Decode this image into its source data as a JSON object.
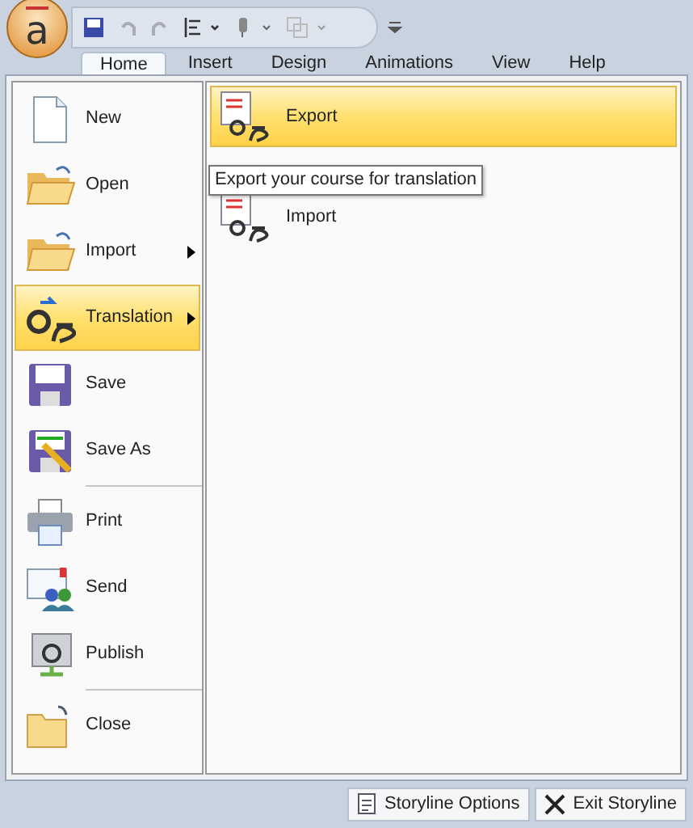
{
  "app_button": {
    "label": "a"
  },
  "tabs": [
    {
      "label": "Home",
      "selected": true
    },
    {
      "label": "Insert",
      "selected": false
    },
    {
      "label": "Design",
      "selected": false
    },
    {
      "label": "Animations",
      "selected": false
    },
    {
      "label": "View",
      "selected": false
    },
    {
      "label": "Help",
      "selected": false
    }
  ],
  "menu": [
    {
      "label": "New",
      "selected": false,
      "has_submenu": false,
      "separator_before": false
    },
    {
      "label": "Open",
      "selected": false,
      "has_submenu": false,
      "separator_before": false
    },
    {
      "label": "Import",
      "selected": false,
      "has_submenu": true,
      "separator_before": false
    },
    {
      "label": "Translation",
      "selected": true,
      "has_submenu": true,
      "separator_before": false
    },
    {
      "label": "Save",
      "selected": false,
      "has_submenu": false,
      "separator_before": false
    },
    {
      "label": "Save As",
      "selected": false,
      "has_submenu": false,
      "separator_before": false
    },
    {
      "label": "Print",
      "selected": false,
      "has_submenu": false,
      "separator_before": true
    },
    {
      "label": "Send",
      "selected": false,
      "has_submenu": false,
      "separator_before": false
    },
    {
      "label": "Publish",
      "selected": false,
      "has_submenu": false,
      "separator_before": false
    },
    {
      "label": "Close",
      "selected": false,
      "has_submenu": false,
      "separator_before": true
    }
  ],
  "submenu": [
    {
      "label": "Export",
      "selected": true
    },
    {
      "label": "Import",
      "selected": false
    }
  ],
  "tooltip": "Export your course for translation",
  "footer_buttons": [
    {
      "label": "Storyline Options"
    },
    {
      "label": "Exit Storyline"
    }
  ]
}
